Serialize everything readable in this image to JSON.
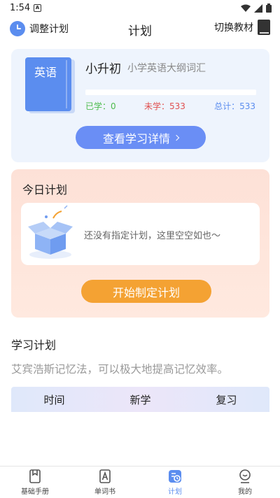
{
  "status_bar": {
    "time": "1:54",
    "notification_letter": "A"
  },
  "header": {
    "adjust_label": "调整计划",
    "title": "计划",
    "switch_label": "切换教材"
  },
  "book": {
    "cover_title": "英语",
    "name": "小升初",
    "subtitle": "小学英语大纲词汇",
    "progress_fraction": 0,
    "learned": "已学：0",
    "unlearned": "未学：533",
    "total": "总计：533",
    "detail_button": "查看学习详情"
  },
  "today": {
    "title": "今日计划",
    "empty_text": "还没有指定计划，这里空空如也～",
    "start_button": "开始制定计划"
  },
  "study_plan": {
    "title": "学习计划",
    "description": "艾宾浩斯记忆法，可以极大地提高记忆效率。",
    "columns": [
      "时间",
      "新学",
      "复习"
    ]
  },
  "tabs": [
    {
      "label": "基础手册",
      "icon": "manual-icon",
      "active": false
    },
    {
      "label": "单词书",
      "icon": "word-book-icon",
      "active": false
    },
    {
      "label": "计划",
      "icon": "plan-icon",
      "active": true
    },
    {
      "label": "我的",
      "icon": "profile-icon",
      "active": false
    }
  ],
  "colors": {
    "accent": "#5b8def",
    "orange": "#f4a233",
    "learned": "#4cbb4c",
    "unlearned": "#e05050"
  }
}
